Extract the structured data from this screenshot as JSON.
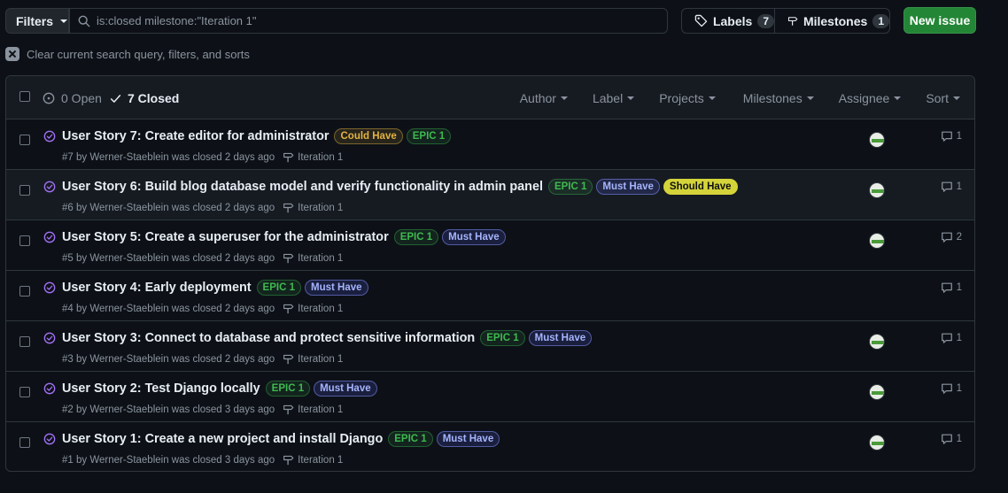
{
  "toolbar": {
    "filters_label": "Filters",
    "search_value": "is:closed milestone:\"Iteration 1\"",
    "labels_label": "Labels",
    "labels_count": "7",
    "milestones_label": "Milestones",
    "milestones_count": "1",
    "new_issue_label": "New issue"
  },
  "clear_text": "Clear current search query, filters, and sorts",
  "header": {
    "open_label": "0 Open",
    "closed_label": "7 Closed",
    "filters": [
      "Author",
      "Label",
      "Projects",
      "Milestones",
      "Assignee",
      "Sort"
    ]
  },
  "colors": {
    "could_have": "#e3b341",
    "epic": "#3fb950",
    "must_have": "#a5b4fc",
    "should_have": "#d4d43a"
  },
  "issues": [
    {
      "title": "User Story 7: Create editor for administrator",
      "labels": [
        {
          "text": "Could Have",
          "kind": "could"
        },
        {
          "text": "EPIC 1",
          "kind": "epic"
        }
      ],
      "meta": "#7 by Werner-Staeblein was closed 2 days ago",
      "milestone": "Iteration 1",
      "has_avatar": true,
      "comments": "1"
    },
    {
      "title": "User Story 6: Build blog database model and verify functionality in admin panel",
      "labels": [
        {
          "text": "EPIC 1",
          "kind": "epic"
        },
        {
          "text": "Must Have",
          "kind": "must"
        },
        {
          "text": "Should Have",
          "kind": "should"
        }
      ],
      "meta": "#6 by Werner-Staeblein was closed 2 days ago",
      "milestone": "Iteration 1",
      "has_avatar": true,
      "comments": "1"
    },
    {
      "title": "User Story 5: Create a superuser for the administrator",
      "labels": [
        {
          "text": "EPIC 1",
          "kind": "epic"
        },
        {
          "text": "Must Have",
          "kind": "must"
        }
      ],
      "meta": "#5 by Werner-Staeblein was closed 2 days ago",
      "milestone": "Iteration 1",
      "has_avatar": true,
      "comments": "2"
    },
    {
      "title": "User Story 4: Early deployment",
      "labels": [
        {
          "text": "EPIC 1",
          "kind": "epic"
        },
        {
          "text": "Must Have",
          "kind": "must"
        }
      ],
      "meta": "#4 by Werner-Staeblein was closed 2 days ago",
      "milestone": "Iteration 1",
      "has_avatar": false,
      "comments": "1"
    },
    {
      "title": "User Story 3: Connect to database and protect sensitive information",
      "labels": [
        {
          "text": "EPIC 1",
          "kind": "epic"
        },
        {
          "text": "Must Have",
          "kind": "must"
        }
      ],
      "meta": "#3 by Werner-Staeblein was closed 2 days ago",
      "milestone": "Iteration 1",
      "has_avatar": true,
      "comments": "1"
    },
    {
      "title": "User Story 2: Test Django locally",
      "labels": [
        {
          "text": "EPIC 1",
          "kind": "epic"
        },
        {
          "text": "Must Have",
          "kind": "must"
        }
      ],
      "meta": "#2 by Werner-Staeblein was closed 3 days ago",
      "milestone": "Iteration 1",
      "has_avatar": true,
      "comments": "1"
    },
    {
      "title": "User Story 1: Create a new project and install Django",
      "labels": [
        {
          "text": "EPIC 1",
          "kind": "epic"
        },
        {
          "text": "Must Have",
          "kind": "must"
        }
      ],
      "meta": "#1 by Werner-Staeblein was closed 3 days ago",
      "milestone": "Iteration 1",
      "has_avatar": true,
      "comments": "1"
    }
  ]
}
